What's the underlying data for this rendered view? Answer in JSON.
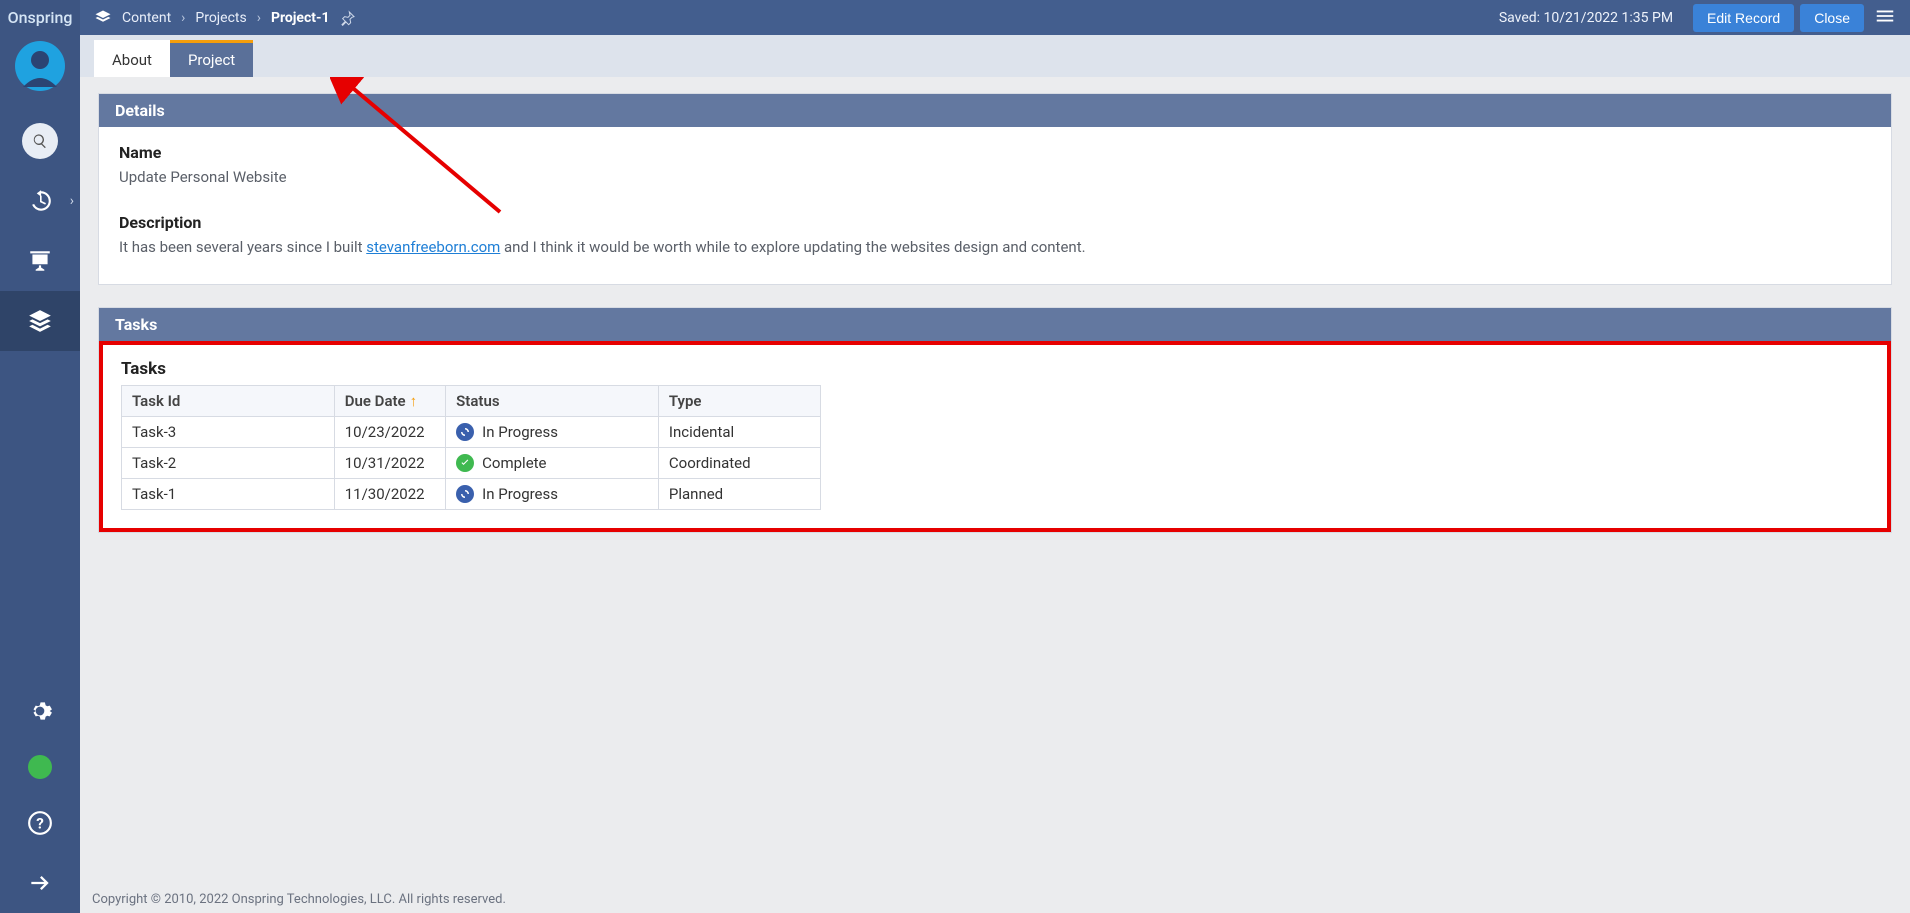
{
  "app": {
    "logo": "Onspring"
  },
  "breadcrumb": {
    "root": "Content",
    "level1": "Projects",
    "current": "Project-1"
  },
  "header": {
    "saved": "Saved: 10/21/2022 1:35 PM",
    "edit_label": "Edit Record",
    "close_label": "Close"
  },
  "tabs": {
    "about": "About",
    "project": "Project"
  },
  "details": {
    "title": "Details",
    "name_label": "Name",
    "name_value": "Update Personal Website",
    "desc_label": "Description",
    "desc_pre": "It has been several years since I built ",
    "desc_link": "stevanfreeborn.com",
    "desc_post": " and I think it would be worth while to explore updating the websites design and content."
  },
  "tasks_panel": {
    "title": "Tasks",
    "grid_title": "Tasks",
    "columns": {
      "id": "Task Id",
      "due": "Due Date",
      "status": "Status",
      "type": "Type"
    },
    "rows": [
      {
        "id": "Task-3",
        "due": "10/23/2022",
        "status": "In Progress",
        "status_kind": "inprog",
        "type": "Incidental"
      },
      {
        "id": "Task-2",
        "due": "10/31/2022",
        "status": "Complete",
        "status_kind": "complete",
        "type": "Coordinated"
      },
      {
        "id": "Task-1",
        "due": "11/30/2022",
        "status": "In Progress",
        "status_kind": "inprog",
        "type": "Planned"
      }
    ]
  },
  "footer": {
    "copyright": "Copyright © 2010, 2022 Onspring Technologies, LLC. All rights reserved."
  }
}
